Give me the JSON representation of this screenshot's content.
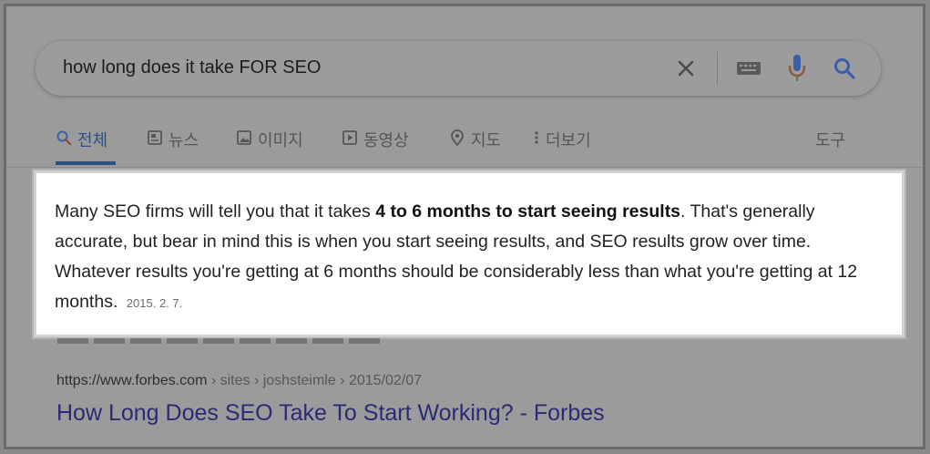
{
  "search": {
    "query": "how long does it take FOR SEO",
    "icons": [
      "close-icon",
      "keyboard-icon",
      "microphone-icon",
      "search-icon"
    ],
    "mic_color": "#3a5fa8",
    "search_icon_color": "#3a5fa8"
  },
  "tabs": [
    {
      "label": "전체",
      "icon": "search-icon",
      "active": true
    },
    {
      "label": "뉴스",
      "icon": "news-icon",
      "active": false
    },
    {
      "label": "이미지",
      "icon": "image-icon",
      "active": false
    },
    {
      "label": "동영상",
      "icon": "video-icon",
      "active": false
    },
    {
      "label": "지도",
      "icon": "map-pin-icon",
      "active": false
    },
    {
      "label": "더보기",
      "icon": "more-vertical-icon",
      "active": false
    }
  ],
  "tools_label": "도구",
  "featured_snippet": {
    "text_before": "Many SEO firms will tell you that it takes ",
    "text_bold": "4 to 6 months to start seeing results",
    "text_after": ". That's generally accurate, but bear in mind this is when you start seeing results, and SEO results grow over time. Whatever results you're getting at 6 months should be considerably less than what you're getting at 12 months.",
    "date": "2015. 2. 7."
  },
  "result": {
    "domain": "https://www.forbes.com",
    "path": " › sites › joshsteimle › 2015/02/07",
    "title": "How Long Does SEO Take To Start Working? - Forbes"
  },
  "colors": {
    "overlay_background": "#9b9b9b",
    "active_tab": "#2c4f86",
    "result_link": "#2a2b74"
  }
}
